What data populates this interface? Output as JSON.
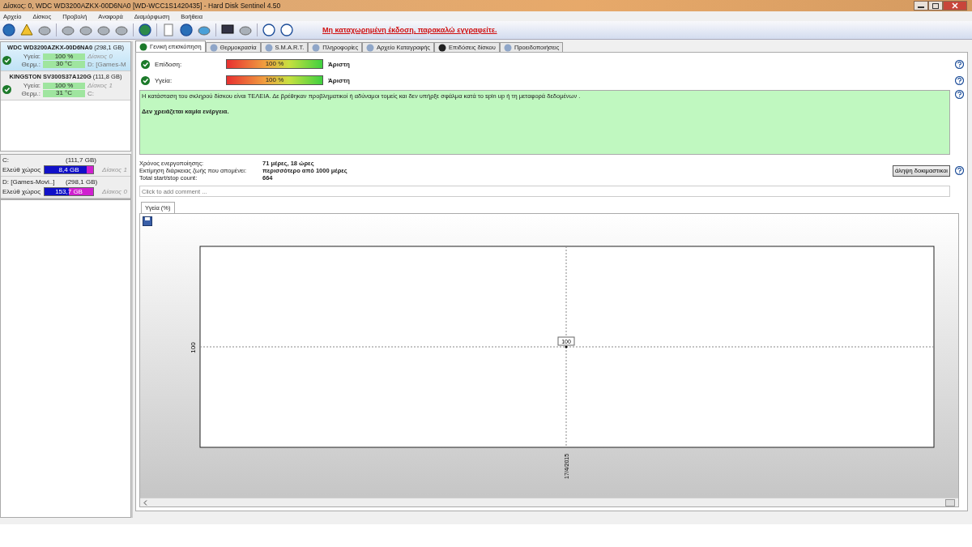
{
  "window": {
    "title": "Δίσκος: 0, WDC WD3200AZKX-00D6NA0 [WD-WCC1S1420435]  -  Hard Disk Sentinel 4.50"
  },
  "menu": [
    "Αρχείο",
    "Δίσκος",
    "Προβολή",
    "Αναφορά",
    "Διαμόρφωση",
    "Βοήθεια"
  ],
  "toolbar": {
    "notice": "Μη καταχωρημένη έκδοση, παρακαλώ εγγραφείτε."
  },
  "disks": [
    {
      "name": "WDC WD3200AZKX-00D6NA0",
      "size": "(298,1 GB)",
      "selected": true,
      "health_label": "Υγεία:",
      "health": "100 %",
      "level": 1,
      "temp_label": "Θερμ.:",
      "temp": "30 °C",
      "disk": "Δίσκος 0",
      "drive": "D: [Games-M"
    },
    {
      "name": "KINGSTON SV300S37A120G",
      "size": "(111,8 GB)",
      "selected": false,
      "health_label": "Υγεία:",
      "health": "100 %",
      "level": 1,
      "temp_label": "Θερμ.:",
      "temp": "31 °C",
      "disk": "Δίσκος 1",
      "drive": "C:"
    }
  ],
  "volumes": [
    {
      "name": "C:",
      "size": "(111,7 GB)",
      "free_label": "Ελεύθ χώρος",
      "free": "8,4 GB",
      "level": 0.87,
      "disk": "Δίσκος 1"
    },
    {
      "name": "D: [Games-Movi..]",
      "size": "(298,1 GB)",
      "free_label": "Ελεύθ χώρος",
      "free": "153,7 GB",
      "level": 0.5,
      "disk": "Δίσκος 0"
    }
  ],
  "tabs": [
    {
      "label": "Γενική επισκόπηση",
      "selected": true
    },
    {
      "label": "Θερμοκρασία",
      "selected": false
    },
    {
      "label": "S.M.A.R.T.",
      "selected": false
    },
    {
      "label": "Πληροφορίες",
      "selected": false
    },
    {
      "label": "Αρχείο Καταγραφής",
      "selected": false
    },
    {
      "label": "Επιδόσεις δίσκου",
      "selected": false
    },
    {
      "label": "Προειδοποιήσεις",
      "selected": false
    }
  ],
  "metrics": [
    {
      "label": "Επίδοση:",
      "value": "100 %",
      "level": 1,
      "rating": "Άριστη"
    },
    {
      "label": "Υγεία:",
      "value": "100 %",
      "level": 1,
      "rating": "Άριστη"
    }
  ],
  "status_box": {
    "text": "Η κατάσταση του σκληρού δίσκου είναι ΤΕΛΕΙΑ. Δε βρέθηκαν προβληματικοί ή αδύναμοι τομείς και δεν υπήρξε σφάλμα κατά το spin up ή τη μεταφορά δεδομένων .",
    "action": "Δεν χρειάζεται καμία ενέργεια."
  },
  "stats": [
    {
      "label": "Χρόνος ενεργοποίησης:",
      "value": "71 μέρες, 18 ώρες"
    },
    {
      "label": "Εκτίμηση διάρκειας ζωής που απομένει:",
      "value": "περισσότερο από 1000 μέρες"
    },
    {
      "label": "Total start/stop count:",
      "value": "664"
    }
  ],
  "test_button": "άληψη δοκιμαστικοι",
  "comment": {
    "placeholder": "Click to add comment ..."
  },
  "chart_tab": "Υγεία (%)",
  "chart": {
    "y_label": "100",
    "point_label": "100",
    "x_label": "17/4/2015"
  }
}
